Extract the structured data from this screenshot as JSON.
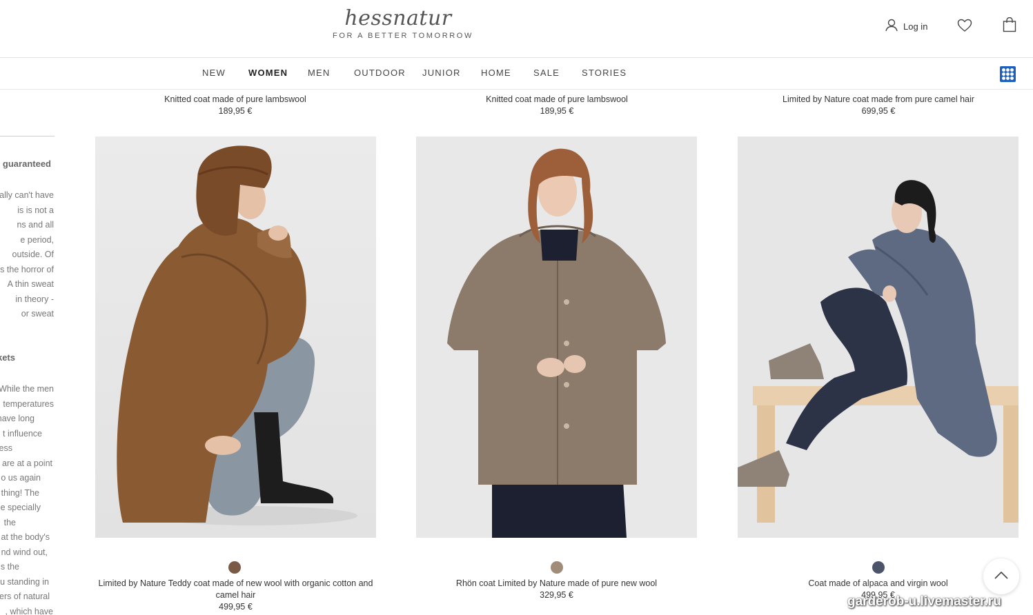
{
  "brand": {
    "name": "hessnatur",
    "tagline": "FOR A BETTER TOMORROW"
  },
  "header": {
    "login_label": "Log in",
    "icons": [
      "user-icon",
      "heart-icon",
      "bag-icon"
    ]
  },
  "nav": {
    "items": [
      "NEW",
      "WOMEN",
      "MEN",
      "OUTDOOR",
      "JUNIOR",
      "HOME",
      "SALE",
      "STORIES"
    ],
    "active": "WOMEN"
  },
  "top_row": [
    {
      "title": "Knitted coat made of pure lambswool",
      "price": "189,95 €"
    },
    {
      "title": "Knitted coat made of pure lambswool",
      "price": "189,95 €"
    },
    {
      "title": "Limited by Nature coat made from pure camel hair",
      "price": "699,95 €"
    }
  ],
  "side_article": {
    "heading_1": "e guaranteed",
    "para_1": [
      "ally can't have",
      "is is not a",
      "ns and all",
      "e period,",
      "outside. Of",
      "s the horror of",
      "A thin sweat",
      "in theory -",
      "or sweat"
    ],
    "heading_2": "kets",
    "para_2": [
      "While the men",
      "temperatures",
      "have long",
      "t influence",
      "ess",
      "are at a point",
      "o us again",
      "thing! The",
      "e specially",
      "the",
      "at the body's",
      "nd wind out,",
      "s the",
      "u standing in",
      "ers of natural",
      ", which have"
    ]
  },
  "products": [
    {
      "title": "Limited by Nature Teddy coat made of new wool with organic cotton and camel hair",
      "price": "499,95 €",
      "swatch": "#7a5a45"
    },
    {
      "title": "Rhön coat Limited by Nature made of pure new wool",
      "price": "329,95 €",
      "swatch": "#a08c78"
    },
    {
      "title": "Coat made of alpaca and virgin wool",
      "price": "499,95 €",
      "swatch": "#4b5468"
    }
  ],
  "watermark": "garderob-u.livemaster.ru"
}
